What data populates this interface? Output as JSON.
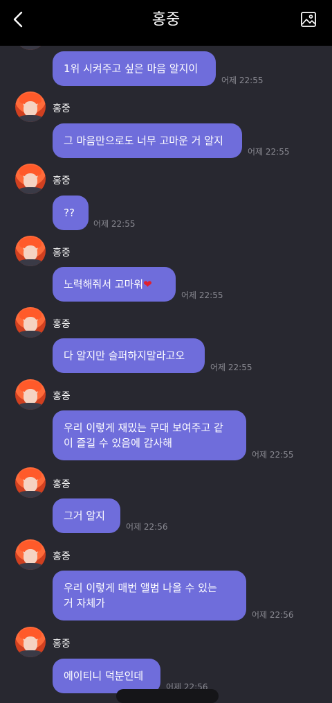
{
  "header": {
    "title": "홍중",
    "back_icon": "chevron-left-icon",
    "gallery_icon": "image-icon"
  },
  "messages": [
    {
      "text": "1위 시켜주고 싶은 마음 알지이",
      "time": "어제 22:55"
    },
    {
      "sender": "홍중",
      "text": "그 마음만으로도 너무 고마운 거 알지",
      "time": "어제 22:55"
    },
    {
      "sender": "홍중",
      "text": "??",
      "time": "어제 22:55"
    },
    {
      "sender": "홍중",
      "text": "노력해줘서 고마워",
      "emoji": "❤",
      "time": "어제 22:55"
    },
    {
      "sender": "홍중",
      "text": "다 알지만 슬퍼하지말라고오",
      "time": "어제 22:55"
    },
    {
      "sender": "홍중",
      "text": "우리 이렇게 재밌는 무대 보여주고 같\n이 즐길 수 있음에 감사해",
      "time": "어제 22:55"
    },
    {
      "sender": "홍중",
      "text": "그거 알지",
      "time": "어제 22:56"
    },
    {
      "sender": "홍중",
      "text": "우리 이렇게 매번 앨범 나올 수 있는\n거 자체가",
      "time": "어제 22:56"
    },
    {
      "sender": "홍중",
      "text": "에이티니 덕분인데",
      "time": "어제 22:56"
    }
  ]
}
